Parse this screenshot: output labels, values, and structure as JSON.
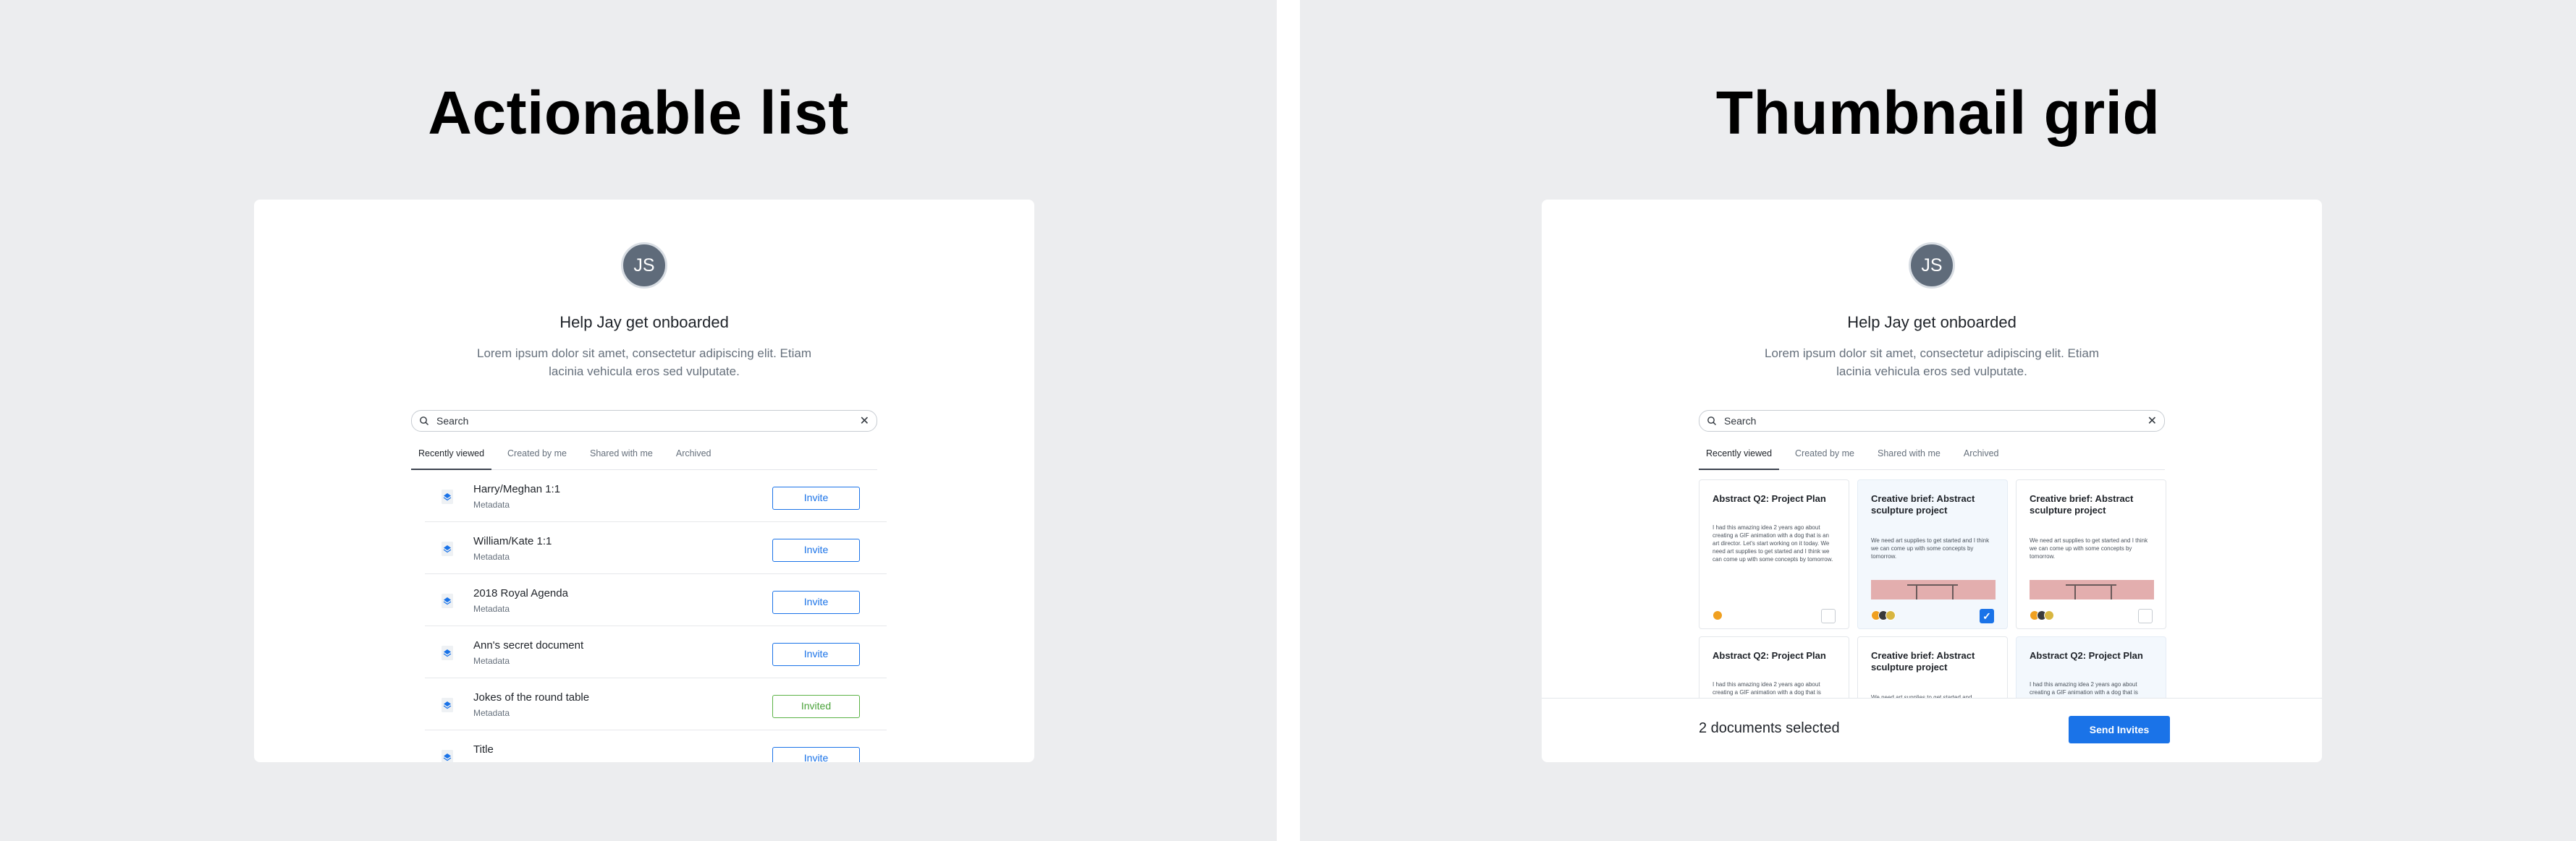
{
  "left": {
    "title": "Actionable list",
    "avatar_initials": "JS",
    "heading": "Help Jay get onboarded",
    "description": "Lorem ipsum dolor sit amet, consectetur adipiscing elit. Etiam lacinia vehicula eros sed vulputate.",
    "search": {
      "value": "Search",
      "icon": "search-icon",
      "clear_icon": "close-icon"
    },
    "tabs": [
      {
        "label": "Recently viewed",
        "active": true
      },
      {
        "label": "Created by me",
        "active": false
      },
      {
        "label": "Shared with me",
        "active": false
      },
      {
        "label": "Archived",
        "active": false
      }
    ],
    "rows": [
      {
        "title": "Harry/Meghan 1:1",
        "meta": "Metadata",
        "action": "Invite"
      },
      {
        "title": "William/Kate 1:1",
        "meta": "Metadata",
        "action": "Invite"
      },
      {
        "title": "2018 Royal Agenda",
        "meta": "Metadata",
        "action": "Invite"
      },
      {
        "title": "Ann's secret document",
        "meta": "Metadata",
        "action": "Invite"
      },
      {
        "title": "Jokes of the round table",
        "meta": "Metadata",
        "action": "Invited"
      },
      {
        "title": "Title",
        "meta": "",
        "action": "Invite"
      }
    ]
  },
  "right": {
    "title": "Thumbnail grid",
    "avatar_initials": "JS",
    "heading": "Help Jay get onboarded",
    "description": "Lorem ipsum dolor sit amet, consectetur adipiscing elit. Etiam lacinia vehicula eros sed vulputate.",
    "search": {
      "value": "Search",
      "icon": "search-icon",
      "clear_icon": "close-icon"
    },
    "tabs": [
      {
        "label": "Recently viewed",
        "active": true
      },
      {
        "label": "Created by me",
        "active": false
      },
      {
        "label": "Shared with me",
        "active": false
      },
      {
        "label": "Archived",
        "active": false
      }
    ],
    "tiles": [
      {
        "title": "Abstract Q2: Project Plan",
        "body": "I had this amazing idea 2 years ago about creating a GIF animation with a dog that is an art director. Let's start working on it today. We need art supplies to get started and I think we can come up with some concepts by tomorrow.",
        "selected": false
      },
      {
        "title": "Creative brief: Abstract sculpture project",
        "body": "We need art supplies to get started and I think we can come up with some concepts by tomorrow.",
        "selected": true
      },
      {
        "title": "Creative brief: Abstract sculpture project",
        "body": "We need art supplies to get started and I think we can come up with some concepts by tomorrow.",
        "selected": false
      },
      {
        "title": "Abstract Q2: Project Plan",
        "body": "I had this amazing idea 2 years ago about creating a GIF animation with a dog that is",
        "selected": false
      },
      {
        "title": "Creative brief: Abstract sculpture project",
        "body": "We need art supplies to get started and",
        "selected": false
      },
      {
        "title": "Abstract Q2: Project Plan",
        "body": "I had this amazing idea 2 years ago about creating a GIF animation with a dog that is",
        "selected": true
      }
    ],
    "footer": {
      "count": "2 documents selected",
      "send": "Send Invites"
    }
  },
  "colors": {
    "accent": "#1a73e8",
    "invited": "#5bb346",
    "avatar_bg": "#5f6b7a",
    "background": "#ecedef"
  }
}
